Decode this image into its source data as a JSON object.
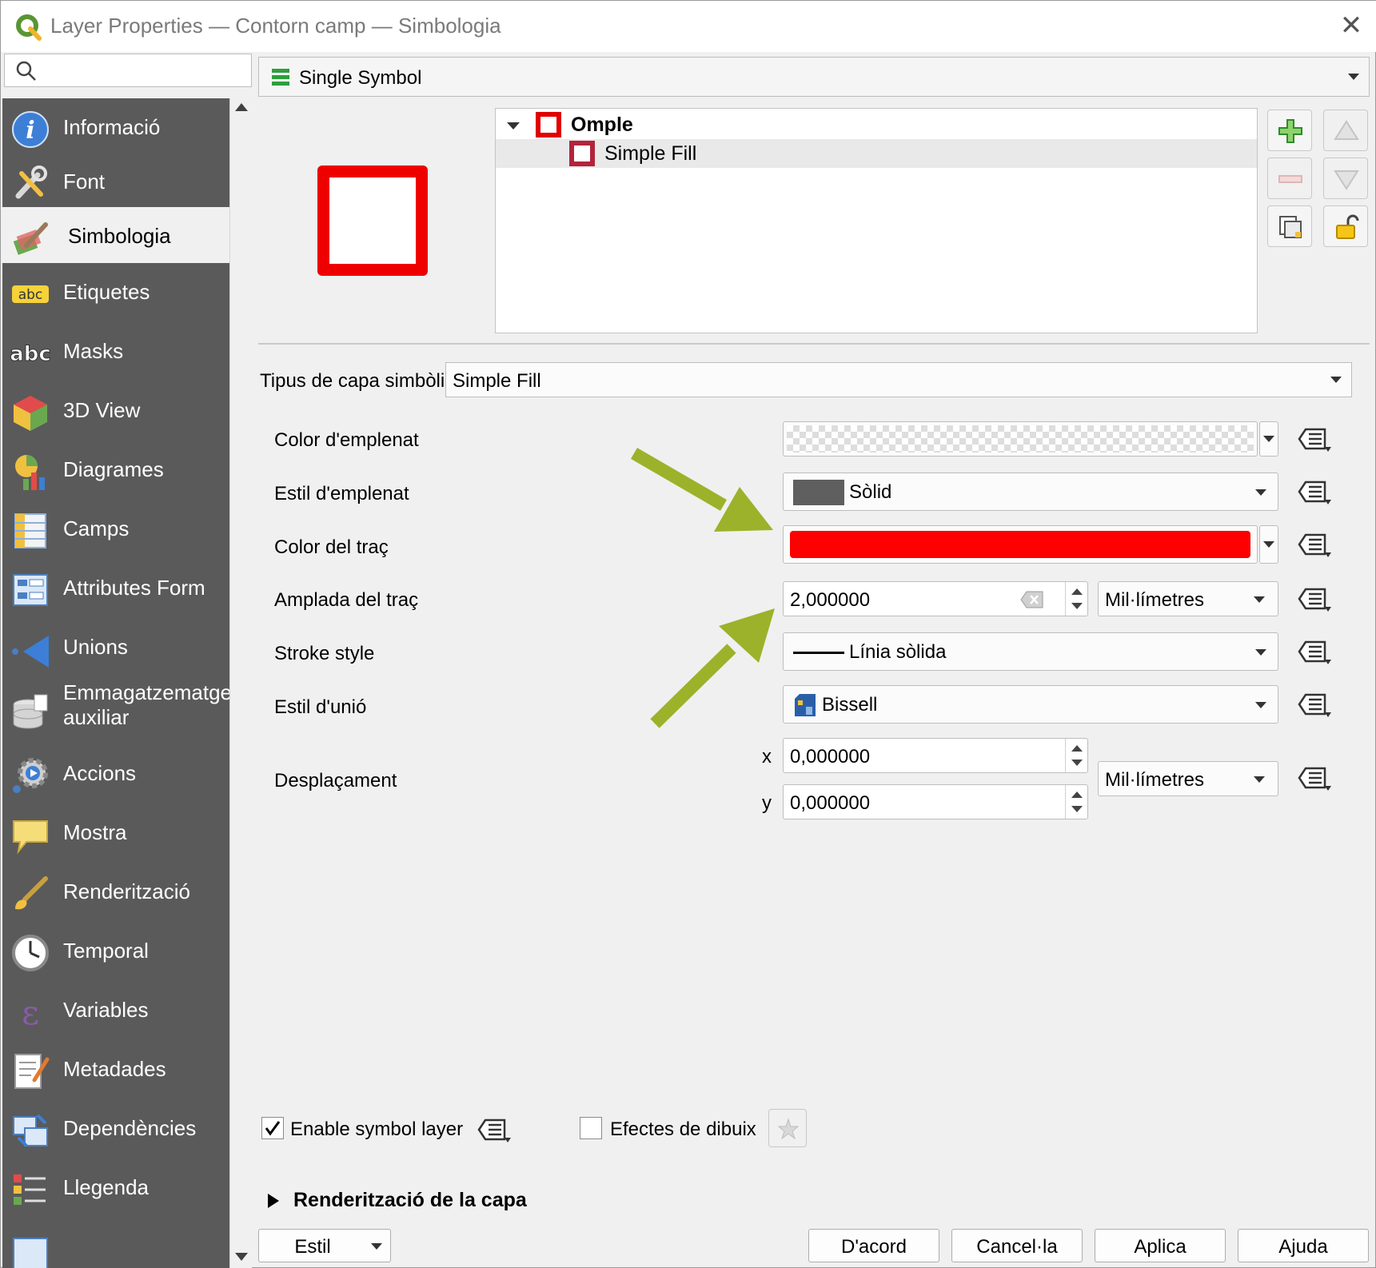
{
  "window": {
    "title": "Layer Properties — Contorn camp — Simbologia"
  },
  "sidebar": {
    "items": [
      {
        "label": "Informació",
        "icon": "info-icon"
      },
      {
        "label": "Font",
        "icon": "source-tools-icon"
      },
      {
        "label": "Simbologia",
        "icon": "symbology-brush-icon",
        "active": true
      },
      {
        "label": "Etiquetes",
        "icon": "labels-abc-icon"
      },
      {
        "label": "Masks",
        "icon": "masks-abc-icon"
      },
      {
        "label": "3D View",
        "icon": "cube-3d-icon"
      },
      {
        "label": "Diagrames",
        "icon": "diagram-icon"
      },
      {
        "label": "Camps",
        "icon": "fields-table-icon"
      },
      {
        "label": "Attributes Form",
        "icon": "attributes-form-icon"
      },
      {
        "label": "Unions",
        "icon": "joins-icon"
      },
      {
        "label": "Emmagatzematge auxiliar",
        "icon": "auxiliary-storage-icon"
      },
      {
        "label": "Accions",
        "icon": "actions-gear-icon"
      },
      {
        "label": "Mostra",
        "icon": "display-tip-icon"
      },
      {
        "label": "Renderització",
        "icon": "rendering-brush-icon"
      },
      {
        "label": "Temporal",
        "icon": "clock-icon"
      },
      {
        "label": "Variables",
        "icon": "variables-epsilon-icon"
      },
      {
        "label": "Metadades",
        "icon": "metadata-icon"
      },
      {
        "label": "Dependències",
        "icon": "dependencies-icon"
      },
      {
        "label": "Llegenda",
        "icon": "legend-icon"
      }
    ]
  },
  "renderer": {
    "label": "Single Symbol"
  },
  "symbol_tree": {
    "root": "Omple",
    "child": "Simple Fill"
  },
  "form": {
    "layer_type_label": "Tipus de capa simbòlica",
    "layer_type_value": "Simple Fill",
    "fill_color_label": "Color d'emplenat",
    "fill_style_label": "Estil d'emplenat",
    "fill_style_value": "Sòlid",
    "stroke_color_label": "Color del traç",
    "stroke_color_value": "#ff0000",
    "stroke_width_label": "Amplada del traç",
    "stroke_width_value": "2,000000",
    "stroke_width_unit": "Mil·límetres",
    "stroke_style_label": "Stroke style",
    "stroke_style_value": "Línia sòlida",
    "join_style_label": "Estil d'unió",
    "join_style_value": "Bissell",
    "offset_label": "Desplaçament",
    "offset_x_label": "x",
    "offset_x_value": "0,000000",
    "offset_y_label": "y",
    "offset_y_value": "0,000000",
    "offset_unit": "Mil·límetres"
  },
  "bottom": {
    "enable_layer_label": "Enable symbol layer",
    "enable_layer_checked": true,
    "draw_effects_label": "Efectes de dibuix",
    "draw_effects_checked": false,
    "layer_rendering_label": "Renderització de la capa"
  },
  "buttons": {
    "style": "Estil",
    "ok": "D'acord",
    "cancel": "Cancel·la",
    "apply": "Aplica",
    "help": "Ajuda"
  },
  "colors": {
    "sidebar_bg": "#5a5a5a",
    "stroke_red": "#ff0000",
    "annotation_arrow": "#9cb22a"
  }
}
